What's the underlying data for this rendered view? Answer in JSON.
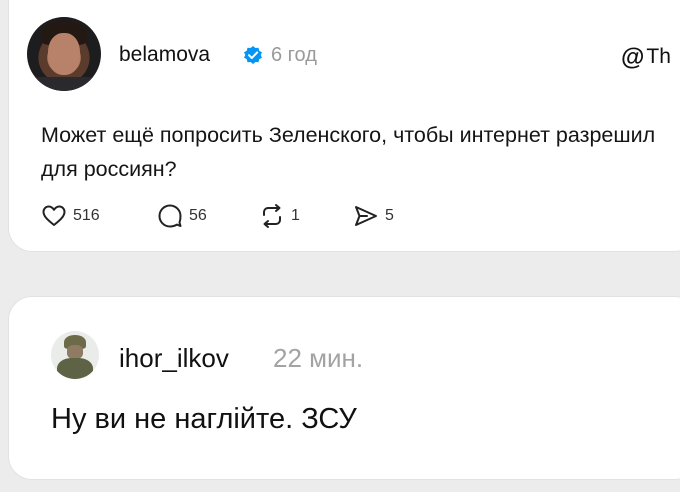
{
  "post": {
    "username": "belamova",
    "verified_icon": "verified-badge-icon",
    "time": "6 год",
    "brand": "Th",
    "text": "Может ещё попросить Зеленского, чтобы интернет разрешил для россиян?",
    "likes": "516",
    "comments": "56",
    "reposts": "1",
    "shares": "5"
  },
  "reply": {
    "username": "ihor_ilkov",
    "time": "22 мин.",
    "text": "Ну ви не наглійте. ЗСУ"
  },
  "colors": {
    "background": "#ececec",
    "card": "#ffffff",
    "verified": "#0095f6",
    "muted": "#9a9a9a"
  }
}
